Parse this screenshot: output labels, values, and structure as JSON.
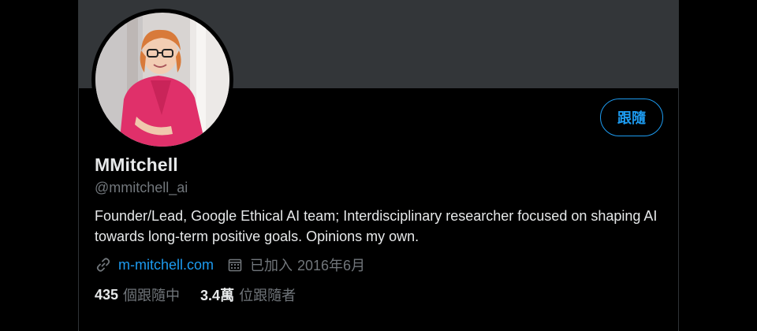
{
  "profile": {
    "display_name": "MMitchell",
    "handle": "@mmitchell_ai",
    "bio": "Founder/Lead, Google Ethical AI team; Interdisciplinary researcher focused on shaping AI towards long-term positive goals. Opinions my own.",
    "website": "m-mitchell.com",
    "joined_label": "已加入",
    "joined_date": "2016年6月"
  },
  "actions": {
    "follow_label": "跟隨"
  },
  "stats": {
    "following_count": "435",
    "following_label": "個跟隨中",
    "followers_count": "3.4萬",
    "followers_label": "位跟隨者"
  },
  "icons": {
    "link": "link-icon",
    "calendar": "calendar-icon"
  },
  "colors": {
    "accent": "#1d9bf0",
    "background": "#000000",
    "banner": "#333639",
    "primary_text": "#e7e9ea",
    "secondary_text": "#71767b"
  }
}
